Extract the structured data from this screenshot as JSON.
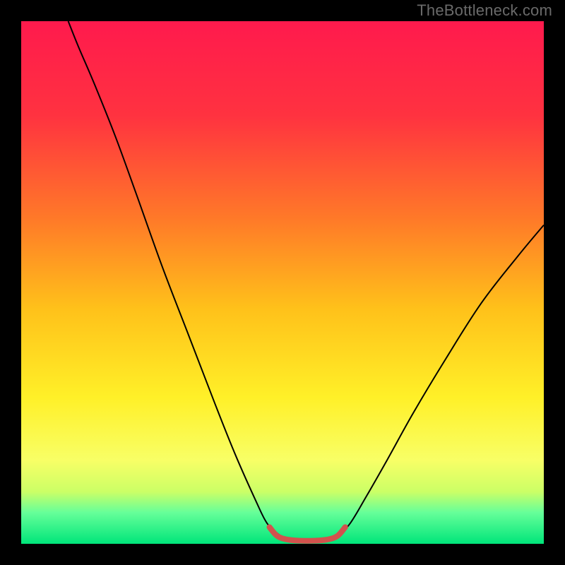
{
  "watermark": "TheBottleneck.com",
  "chart_data": {
    "type": "line",
    "title": "",
    "xlabel": "",
    "ylabel": "",
    "xlim": [
      0,
      100
    ],
    "ylim": [
      0,
      100
    ],
    "grid": false,
    "background_gradient": {
      "type": "vertical-linear",
      "stops": [
        {
          "offset": 0.0,
          "color": "#ff1a4d"
        },
        {
          "offset": 0.18,
          "color": "#ff3240"
        },
        {
          "offset": 0.38,
          "color": "#ff7a28"
        },
        {
          "offset": 0.55,
          "color": "#ffc11a"
        },
        {
          "offset": 0.72,
          "color": "#fff028"
        },
        {
          "offset": 0.84,
          "color": "#f8ff66"
        },
        {
          "offset": 0.9,
          "color": "#ccff66"
        },
        {
          "offset": 0.94,
          "color": "#66ff99"
        },
        {
          "offset": 1.0,
          "color": "#00e57a"
        }
      ]
    },
    "series": [
      {
        "name": "bottleneck-curve",
        "stroke": "#000000",
        "stroke_width": 2,
        "points": [
          {
            "x": 9.0,
            "y": 100.0
          },
          {
            "x": 11.0,
            "y": 95.0
          },
          {
            "x": 14.0,
            "y": 88.0
          },
          {
            "x": 18.0,
            "y": 78.0
          },
          {
            "x": 22.0,
            "y": 67.0
          },
          {
            "x": 27.0,
            "y": 53.0
          },
          {
            "x": 32.0,
            "y": 40.0
          },
          {
            "x": 37.0,
            "y": 27.0
          },
          {
            "x": 41.0,
            "y": 17.0
          },
          {
            "x": 45.0,
            "y": 8.0
          },
          {
            "x": 47.0,
            "y": 4.0
          },
          {
            "x": 49.0,
            "y": 2.0
          },
          {
            "x": 51.0,
            "y": 0.8
          },
          {
            "x": 53.0,
            "y": 0.5
          },
          {
            "x": 56.0,
            "y": 0.5
          },
          {
            "x": 59.0,
            "y": 0.8
          },
          {
            "x": 61.0,
            "y": 2.0
          },
          {
            "x": 63.0,
            "y": 4.0
          },
          {
            "x": 66.0,
            "y": 9.0
          },
          {
            "x": 70.0,
            "y": 16.0
          },
          {
            "x": 75.0,
            "y": 25.0
          },
          {
            "x": 81.0,
            "y": 35.0
          },
          {
            "x": 88.0,
            "y": 46.0
          },
          {
            "x": 95.0,
            "y": 55.0
          },
          {
            "x": 100.0,
            "y": 61.0
          }
        ]
      },
      {
        "name": "valley-marker",
        "stroke": "#d2524d",
        "stroke_width": 8,
        "points": [
          {
            "x": 47.5,
            "y": 3.2
          },
          {
            "x": 49.0,
            "y": 1.5
          },
          {
            "x": 51.0,
            "y": 0.8
          },
          {
            "x": 53.5,
            "y": 0.6
          },
          {
            "x": 56.0,
            "y": 0.6
          },
          {
            "x": 58.5,
            "y": 0.8
          },
          {
            "x": 60.5,
            "y": 1.5
          },
          {
            "x": 62.0,
            "y": 3.2
          }
        ]
      }
    ]
  }
}
